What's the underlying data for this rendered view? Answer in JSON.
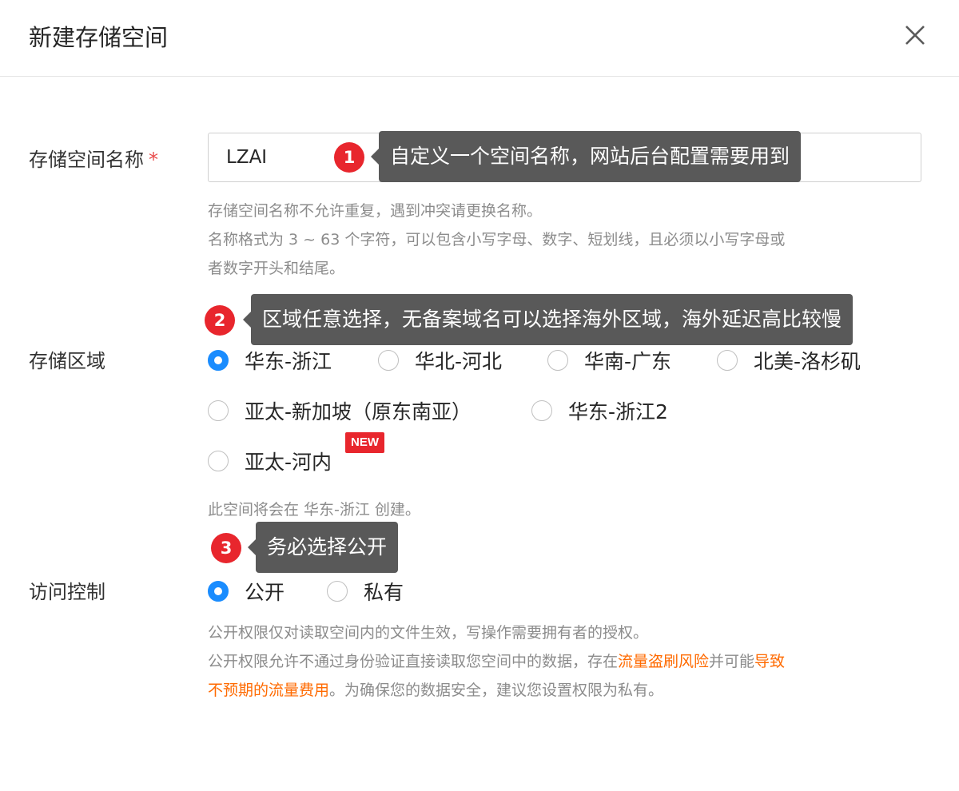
{
  "dialog": {
    "title": "新建存储空间"
  },
  "bucket_name": {
    "label": "存储空间名称",
    "required_mark": "*",
    "value": "LZAI",
    "hint_line1": "存储空间名称不允许重复，遇到冲突请更换名称。",
    "hint_line2": "名称格式为 3 ~ 63 个字符，可以包含小写字母、数字、短划线，且必须以小写字母或",
    "hint_line3": "者数字开头和结尾。"
  },
  "annotations": [
    {
      "number": "1",
      "text": "自定义一个空间名称，网站后台配置需要用到"
    },
    {
      "number": "2",
      "text": "区域任意选择，无备案域名可以选择海外区域，海外延迟高比较慢"
    },
    {
      "number": "3",
      "text": "务必选择公开"
    }
  ],
  "region": {
    "label": "存储区域",
    "options": [
      {
        "label": "华东-浙江",
        "selected": true
      },
      {
        "label": "华北-河北",
        "selected": false
      },
      {
        "label": "华南-广东",
        "selected": false
      },
      {
        "label": "北美-洛杉矶",
        "selected": false
      },
      {
        "label": "亚太-新加坡（原东南亚）",
        "selected": false
      },
      {
        "label": "华东-浙江2",
        "selected": false
      },
      {
        "label": "亚太-河内",
        "selected": false
      }
    ],
    "new_badge": "NEW",
    "note": "此空间将会在 华东-浙江 创建。"
  },
  "access": {
    "label": "访问控制",
    "options": [
      {
        "label": "公开",
        "selected": true
      },
      {
        "label": "私有",
        "selected": false
      }
    ],
    "hint_line1": "公开权限仅对读取空间内的文件生效，写操作需要拥有者的授权。",
    "hint_line2_a": "公开权限允许不通过身份验证直接读取您空间中的数据，存在",
    "hint_line2_b": "流量盗刷风险",
    "hint_line2_c": "并可能",
    "hint_line2_d": "导致",
    "hint_line3_a": "不预期的流量费用",
    "hint_line3_b": "。为确保您的数据安全，建议您设置权限为私有。"
  },
  "colors": {
    "primary": "#1a8cfe",
    "warning": "#ff6a00",
    "badge": "#e8262d",
    "tooltip": "#595959"
  }
}
